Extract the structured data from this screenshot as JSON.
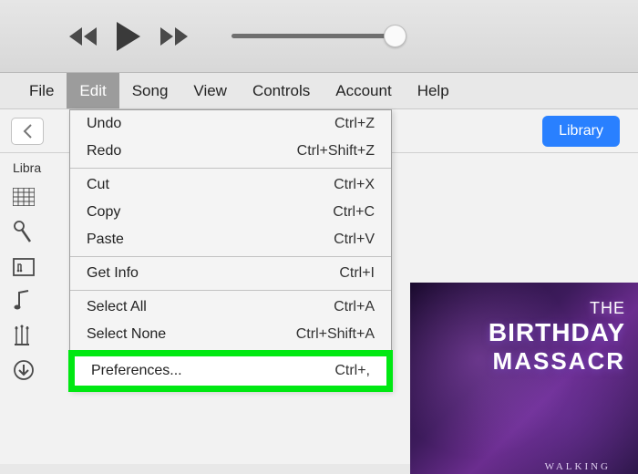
{
  "menubar": {
    "items": [
      "File",
      "Edit",
      "Song",
      "View",
      "Controls",
      "Account",
      "Help"
    ],
    "active_index": 1
  },
  "toolbar": {
    "library_label": "Library"
  },
  "sidebar": {
    "section_label": "Libra"
  },
  "dropdown": {
    "groups": [
      [
        {
          "label": "Undo",
          "shortcut": "Ctrl+Z"
        },
        {
          "label": "Redo",
          "shortcut": "Ctrl+Shift+Z"
        }
      ],
      [
        {
          "label": "Cut",
          "shortcut": "Ctrl+X"
        },
        {
          "label": "Copy",
          "shortcut": "Ctrl+C"
        },
        {
          "label": "Paste",
          "shortcut": "Ctrl+V"
        }
      ],
      [
        {
          "label": "Get Info",
          "shortcut": "Ctrl+I"
        }
      ],
      [
        {
          "label": "Select All",
          "shortcut": "Ctrl+A"
        },
        {
          "label": "Select None",
          "shortcut": "Ctrl+Shift+A"
        }
      ]
    ],
    "highlighted": {
      "label": "Preferences...",
      "shortcut": "Ctrl+,"
    }
  },
  "album": {
    "line1": "THE",
    "line2": "BIRTHDAY",
    "line3": "MASSACR",
    "subtitle": "WALKING"
  }
}
